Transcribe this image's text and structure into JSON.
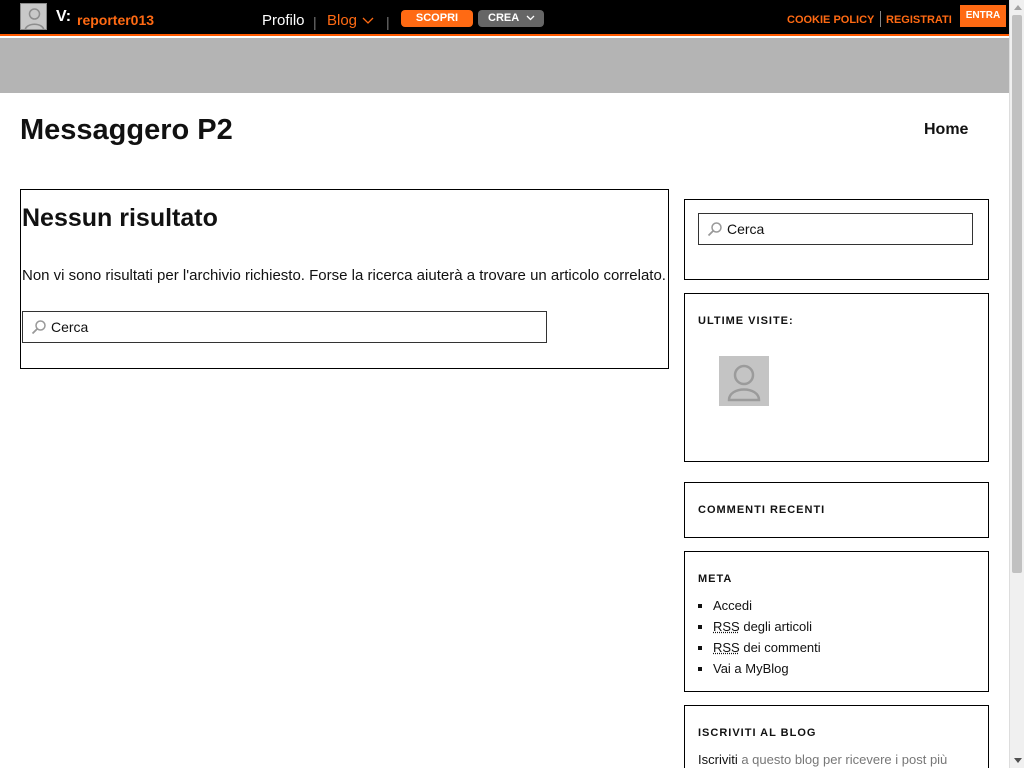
{
  "topbar": {
    "logo": "V:",
    "username": "reporter013",
    "profile_link": "Profilo",
    "separator": "|",
    "blog_menu": "Blog",
    "scopri_button": "SCOPRI",
    "crea_button": "CREA",
    "cookie_policy": "COOKIE POLICY",
    "registrati": "REGISTRATI",
    "entra": "ENTRA",
    "accent_color": "#ff6a13",
    "background_color": "#000000"
  },
  "header": {
    "site_title": "Messaggero P2",
    "nav": {
      "home": "Home"
    }
  },
  "main": {
    "heading": "Nessun risultato",
    "message": "Non vi sono risultati per l'archivio richiesto. Forse la ricerca aiuterà a trovare un articolo correlato.",
    "search_placeholder": "Cerca"
  },
  "sidebar": {
    "search_placeholder": "Cerca",
    "recent_visits": {
      "title": "ULTIME VISITE:"
    },
    "recent_comments": {
      "title": "COMMENTI RECENTI"
    },
    "meta": {
      "title": "META",
      "items": [
        {
          "label": "Accedi"
        },
        {
          "abbr": "RSS",
          "label": " degli articoli"
        },
        {
          "abbr": "RSS",
          "label": " dei commenti"
        },
        {
          "label": "Vai a MyBlog"
        }
      ]
    },
    "subscribe": {
      "title": "ISCRIVITI AL BLOG",
      "link": "Iscriviti",
      "text": " a questo blog per ricevere i post più"
    }
  },
  "icons": {
    "avatar": "user-avatar-icon",
    "search": "search-icon",
    "chevron": "chevron-down-icon"
  }
}
